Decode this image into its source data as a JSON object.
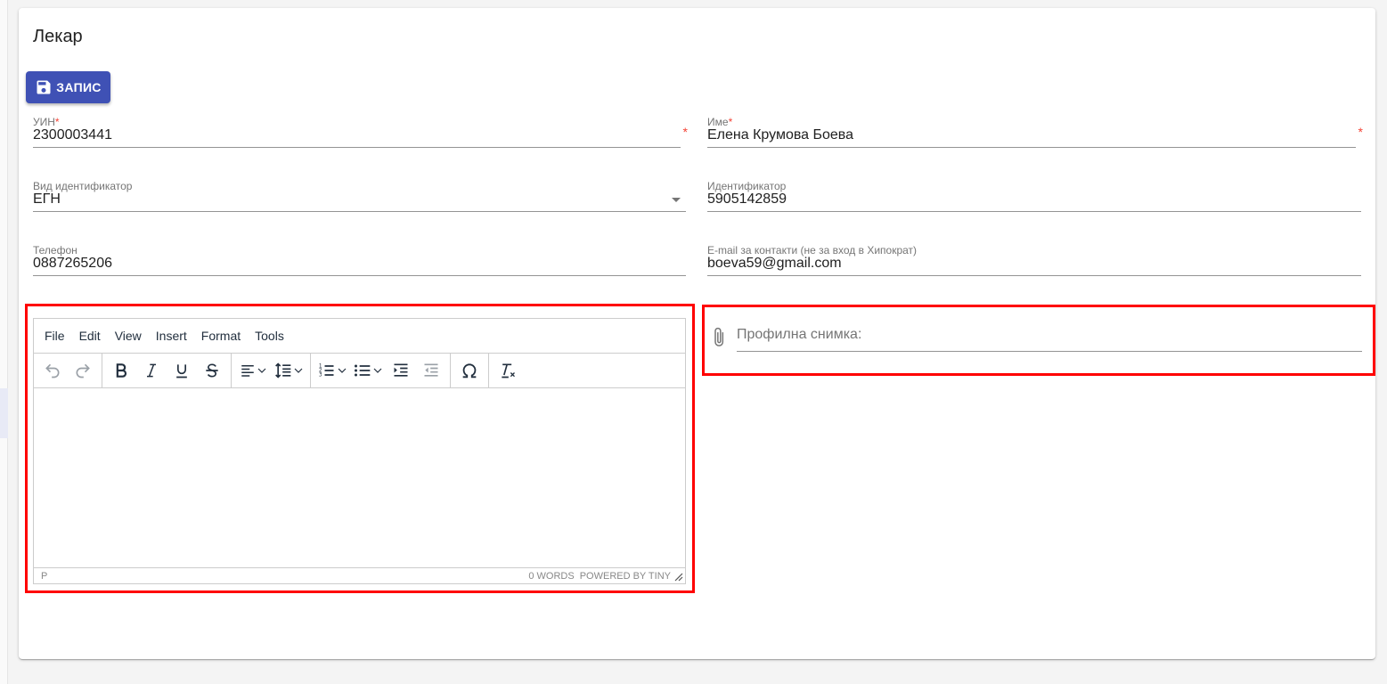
{
  "page": {
    "title": "Лекар"
  },
  "toolbar": {
    "save_label": "ЗАПИС"
  },
  "form": {
    "uin": {
      "label": "УИН",
      "required_mark": "*",
      "value": "2300003441"
    },
    "name": {
      "label": "Име",
      "required_mark": "*",
      "value": "Елена Крумова Боева"
    },
    "id_type": {
      "label": "Вид идентификатор",
      "value": "ЕГН"
    },
    "identifier": {
      "label": "Идентификатор",
      "value": "5905142859"
    },
    "phone": {
      "label": "Телефон",
      "value": "0887265206"
    },
    "email": {
      "label": "E-mail за контакти (не за вход в Хипократ)",
      "value": "boeva59@gmail.com"
    },
    "photo": {
      "label": "Профилна снимка:"
    }
  },
  "editor": {
    "menu": {
      "file": "File",
      "edit": "Edit",
      "view": "View",
      "insert": "Insert",
      "format": "Format",
      "tools": "Tools"
    },
    "status": {
      "path": "P",
      "words": "0 WORDS",
      "powered": "POWERED BY TINY"
    },
    "icons": [
      "undo-icon",
      "redo-icon",
      "bold-icon",
      "italic-icon",
      "underline-icon",
      "strikethrough-icon",
      "align-icon",
      "line-height-icon",
      "numbered-list-icon",
      "bullet-list-icon",
      "indent-icon",
      "outdent-icon",
      "special-character-icon",
      "clear-formatting-icon"
    ]
  },
  "colors": {
    "primary": "#3f51b5",
    "highlight": "#ff0000",
    "required": "#f44336"
  }
}
